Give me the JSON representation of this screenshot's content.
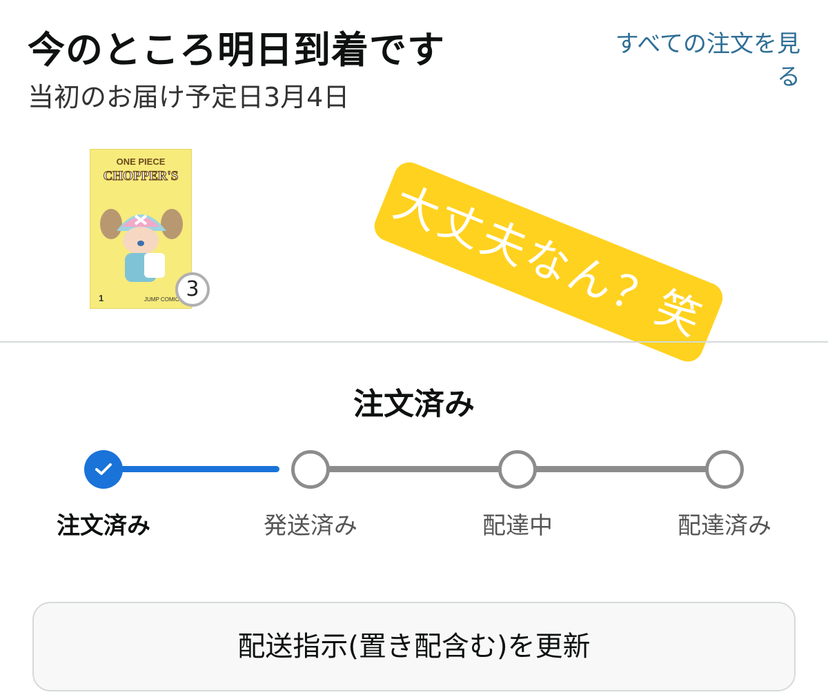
{
  "header": {
    "delivery_status": "今のところ明日到着です",
    "original_delivery": "当初のお届け予定日3月4日",
    "see_all_orders_link": "すべての注文を見る"
  },
  "item": {
    "cover_title_line1": "ONE PIECE",
    "cover_title_line2": "CHOPPER'S",
    "cover_volume": "1",
    "cover_publisher": "JUMP COMICS",
    "quantity": "3"
  },
  "sticker": {
    "text": "大丈夫なん？笑",
    "color": "#ffd21f"
  },
  "tracking": {
    "heading": "注文済み",
    "steps": [
      {
        "label": "注文済み",
        "state": "done"
      },
      {
        "label": "発送済み",
        "state": "pending"
      },
      {
        "label": "配達中",
        "state": "pending"
      },
      {
        "label": "配達済み",
        "state": "pending"
      }
    ],
    "accent_color": "#1a73d9",
    "pending_color": "#8c8c8c"
  },
  "actions": {
    "update_delivery_button": "配送指示(置き配含む)を更新"
  },
  "icons": {
    "step_done": "check-icon"
  }
}
